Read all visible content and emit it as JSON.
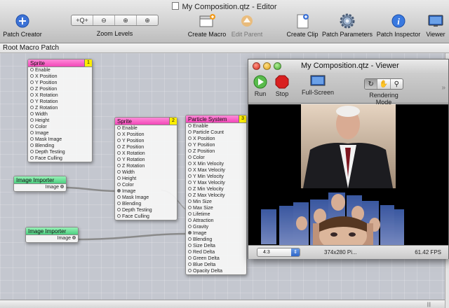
{
  "window": {
    "title": "My Composition.qtz - Editor"
  },
  "toolbar": {
    "patch_creator": "Patch Creator",
    "zoom_levels": "Zoom Levels",
    "zoom_buttons": [
      "+Q+",
      "⊖",
      "⊕",
      "⊕"
    ],
    "create_macro": "Create Macro",
    "edit_parent": "Edit Parent",
    "create_clip": "Create Clip",
    "patch_parameters": "Patch Parameters",
    "patch_inspector": "Patch Inspector",
    "viewer": "Viewer"
  },
  "breadcrumb": "Root Macro Patch",
  "patches": {
    "sprite1": {
      "title": "Sprite",
      "number": "1",
      "ports": [
        "Enable",
        "X Position",
        "Y Position",
        "Z Position",
        "X Rotation",
        "Y Rotation",
        "Z Rotation",
        "Width",
        "Height",
        "Color",
        "Image",
        "Mask Image",
        "Blending",
        "Depth Testing",
        "Face Culling"
      ]
    },
    "sprite2": {
      "title": "Sprite",
      "number": "2",
      "ports": [
        "Enable",
        "X Position",
        "Y Position",
        "Z Position",
        "X Rotation",
        "Y Rotation",
        "Z Rotation",
        "Width",
        "Height",
        "Color",
        "Image",
        "Mask Image",
        "Blending",
        "Depth Testing",
        "Face Culling"
      ]
    },
    "particle": {
      "title": "Particle System",
      "number": "3",
      "ports": [
        "Enable",
        "Particle Count",
        "X Position",
        "Y Position",
        "Z Position",
        "Color",
        "X Min Velocity",
        "X Max Velocity",
        "Y Min Velocity",
        "Y Max Velocity",
        "Z Min Velocity",
        "Z Max Velocity",
        "Min Size",
        "Max Size",
        "Lifetime",
        "Attraction",
        "Gravity",
        "Image",
        "Blending",
        "Size Delta",
        "Red Delta",
        "Green Delta",
        "Blue Delta",
        "Opacity Delta"
      ]
    },
    "importer1": {
      "title": "Image Importer",
      "output": "Image"
    },
    "importer2": {
      "title": "Image Importer",
      "output": "Image"
    }
  },
  "viewer": {
    "title": "My Composition.qtz - Viewer",
    "run": "Run",
    "stop": "Stop",
    "fullscreen": "Full-Screen",
    "rendering_mode": "Rendering Mode",
    "aspect": "4:3",
    "dimensions": "374x280 Pi...",
    "fps": "61.42 FPS"
  },
  "colors": {
    "sprite_header": "#f247b8",
    "importer_header": "#4ccf80",
    "patch_number": "#ffee00",
    "run_green": "#3aa83a",
    "stop_red": "#d92020"
  }
}
